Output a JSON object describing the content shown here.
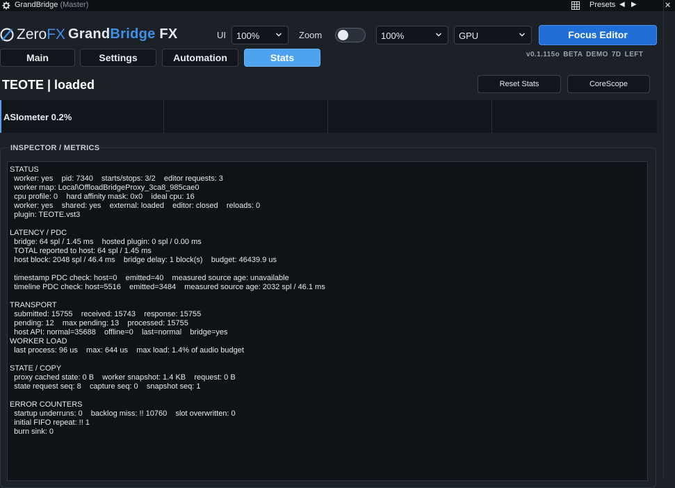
{
  "window": {
    "title": "GrandBridge",
    "subtitle": "(Master)",
    "presets_label": "Presets",
    "prev_glyph": "◀",
    "next_glyph": "▶",
    "close_glyph": "✕",
    "icons": [
      "gear-icon",
      "grid-icon",
      "caret-left-icon",
      "caret-right-icon",
      "close-icon"
    ]
  },
  "header": {
    "logo_zero": "Zero",
    "logo_fx": "FX",
    "brand_grand": "Grand",
    "brand_bridge": "Bridge",
    "brand_fx": " FX",
    "ui_label": "UI",
    "ui_scale": "100%",
    "zoom_label": "Zoom",
    "zoom_toggle_on": false,
    "zoom_value": "100%",
    "renderer": "GPU",
    "focus_editor": "Focus Editor",
    "version": "v0.1.115o  BETA  DEMO  7D LEFT",
    "accent_color": "#3f8fe8",
    "button_color": "#1f6fd6"
  },
  "tabs": [
    {
      "label": "Main",
      "active": false
    },
    {
      "label": "Settings",
      "active": false
    },
    {
      "label": "Automation",
      "active": false
    },
    {
      "label": "Stats",
      "active": true
    }
  ],
  "plugin": {
    "title": "TEOTE  |  loaded",
    "reset_stats": "Reset Stats",
    "corescope": "CoreScope"
  },
  "meter": {
    "label": "ASIometer  0.2%"
  },
  "inspector": {
    "title": "INSPECTOR / METRICS",
    "text": "STATUS\n  worker: yes    pid: 7340    starts/stops: 3/2    editor requests: 3\n  worker map: Local\\OffloadBridgeProxy_3ca8_985cae0\n  cpu profile: 0    hard affinity mask: 0x0    ideal cpu: 16\n  worker: yes    shared: yes    external: loaded    editor: closed    reloads: 0\n  plugin: TEOTE.vst3\n\nLATENCY / PDC\n  bridge: 64 spl / 1.45 ms    hosted plugin: 0 spl / 0.00 ms\n  TOTAL reported to host: 64 spl / 1.45 ms\n  host block: 2048 spl / 46.4 ms    bridge delay: 1 block(s)    budget: 46439.9 us\n\n  timestamp PDC check: host=0    emitted=40    measured source age: unavailable\n  timeline PDC check: host=5516    emitted=3484    measured source age: 2032 spl / 46.1 ms\n\nTRANSPORT\n  submitted: 15755    received: 15743    response: 15755\n  pending: 12    max pending: 13    processed: 15755\n  host API: normal=35688    offline=0    last=normal    bridge=yes\nWORKER LOAD\n  last process: 96 us    max: 644 us    max load: 1.4% of audio budget\n\nSTATE / COPY\n  proxy cached state: 0 B    worker snapshot: 1.4 KB    request: 0 B\n  state request seq: 8    capture seq: 0    snapshot seq: 1\n\nERROR COUNTERS\n  startup underruns: 0    backlog miss: !! 10760    slot overwritten: 0\n  initial FIFO repeat: !! 1\n  burn sink: 0"
  }
}
